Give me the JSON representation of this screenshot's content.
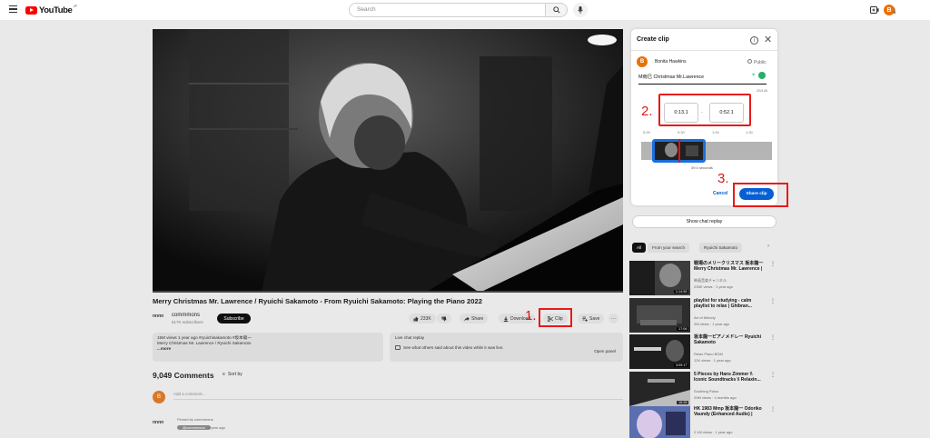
{
  "topbar": {
    "logo_text": "YouTube",
    "logo_sup": "JP",
    "search_placeholder": "Search",
    "avatar_letter": "B"
  },
  "video": {
    "title": "Merry Christmas Mr. Lawrence / Ryuichi Sakamoto - From Ryuichi Sakamoto: Playing the Piano 2022",
    "channel_avatar": "nnnn",
    "channel_name": "commmons",
    "channel_subs": "617K subscribers",
    "subscribe_label": "Subscribe",
    "like_count": "233K",
    "share_label": "Share",
    "download_label": "Download",
    "clip_label": "Clip",
    "save_label": "Save",
    "more_label": "···"
  },
  "description": {
    "line1": "15M views  1 year ago  #ryuichisakamoto  #坂本龍一",
    "line2": "Merry Christmas Mr. Lawrence / Ryuichi Sakamoto",
    "more": "...more"
  },
  "live_chat": {
    "title": "Live chat replay",
    "text": "See what others said about this video while it was live.",
    "open_label": "Open panel"
  },
  "comments": {
    "count": "9,049 Comments",
    "sort_label": "Sort by",
    "add_placeholder": "Add a comment...",
    "user_avatar": "B",
    "pinned_avatar": "nnnn",
    "pinned_text": "Pinned by commmons",
    "pinned_handle": "@commmons",
    "pinned_time": "1 year ago"
  },
  "clip_panel": {
    "title": "Create clip",
    "info_icon": "i",
    "close_icon": "✕",
    "user_avatar": "B",
    "user_name": "Bonita Hawkins",
    "visibility": "Public",
    "clip_name": "M雨巳 Christmas Mr.Lawrence",
    "char_count": "25/140",
    "start_time": "0:13.1",
    "end_time": "0:52.1",
    "dash": "-",
    "ticks": [
      "0:00",
      "0:30",
      "1:00",
      "1:30"
    ],
    "duration": "39.0 seconds",
    "cancel_label": "Cancel",
    "share_label": "Share clip"
  },
  "annotations": {
    "step1": "1.",
    "step2": "2.",
    "step3": "3."
  },
  "sidebar": {
    "chat_replay_label": "Show chat replay",
    "chips": [
      "All",
      "From your search",
      "Ryuichi Sakamoto"
    ],
    "recommendations": [
      {
        "title": "戦場のメリークリスマス 坂本龍一 Merry Christmas Mr. Lawrence |",
        "channel": "映画音楽チャンネル",
        "meta": "235K views · 1 year ago",
        "duration": "1:14:55"
      },
      {
        "title": "playlist for studying - calm playlist to relax | Ghibran...",
        "channel": "Art of Melody",
        "meta": "2M views · 1 year ago",
        "duration": "17:06"
      },
      {
        "title": "坂本龍一ピアノメドレー Ryuichi Sakamoto",
        "channel": "Relax Piano BGM",
        "meta": "12K views · 1 year ago",
        "duration": "3:09:17"
      },
      {
        "title": "5 Pieces by Hans Zimmer \\\\ Iconic Soundtracks \\\\ Relaxin...",
        "channel": "Soothing Piano",
        "meta": "20M views · 4 months ago",
        "duration": "16:28"
      },
      {
        "title": "HK 1983 Mmp 坂本龍一 Odoriko Vaundy (Enhanced Audio) |",
        "channel": "Ryuichi Sakamoto",
        "meta": "2.1M views · 1 year ago",
        "duration": ""
      }
    ]
  },
  "colors": {
    "accent_blue": "#065fd4",
    "annotation_red": "#e81a1a",
    "youtube_red": "#ff0000",
    "avatar_orange": "#e8710a"
  }
}
